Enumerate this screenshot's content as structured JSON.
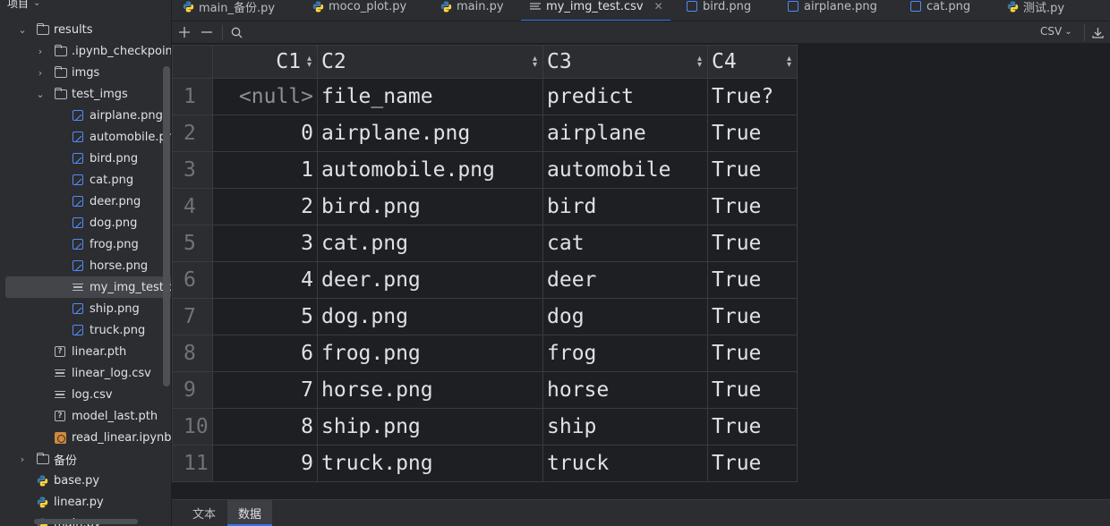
{
  "sidebar": {
    "title": "项目",
    "items": [
      {
        "label": "results",
        "type": "folder",
        "expanded": true,
        "icon": "folder-icon"
      },
      {
        "label": ".ipynb_checkpoints",
        "type": "folder",
        "expanded": false,
        "icon": "folder-icon"
      },
      {
        "label": "imgs",
        "type": "folder",
        "expanded": false,
        "icon": "folder-icon"
      },
      {
        "label": "test_imgs",
        "type": "folder",
        "expanded": true,
        "icon": "folder-icon"
      },
      {
        "label": "airplane.png",
        "type": "image",
        "icon": "image-file-icon"
      },
      {
        "label": "automobile.png",
        "type": "image",
        "icon": "image-file-icon"
      },
      {
        "label": "bird.png",
        "type": "image",
        "icon": "image-file-icon"
      },
      {
        "label": "cat.png",
        "type": "image",
        "icon": "image-file-icon"
      },
      {
        "label": "deer.png",
        "type": "image",
        "icon": "image-file-icon"
      },
      {
        "label": "dog.png",
        "type": "image",
        "icon": "image-file-icon"
      },
      {
        "label": "frog.png",
        "type": "image",
        "icon": "image-file-icon"
      },
      {
        "label": "horse.png",
        "type": "image",
        "icon": "image-file-icon"
      },
      {
        "label": "my_img_test.csv",
        "type": "text",
        "icon": "text-file-icon",
        "selected": true
      },
      {
        "label": "ship.png",
        "type": "image",
        "icon": "image-file-icon"
      },
      {
        "label": "truck.png",
        "type": "image",
        "icon": "image-file-icon"
      },
      {
        "label": "linear.pth",
        "type": "unknown",
        "icon": "unknown-file-icon"
      },
      {
        "label": "linear_log.csv",
        "type": "text",
        "icon": "text-file-icon"
      },
      {
        "label": "log.csv",
        "type": "text",
        "icon": "text-file-icon"
      },
      {
        "label": "model_last.pth",
        "type": "unknown",
        "icon": "unknown-file-icon"
      },
      {
        "label": "read_linear.ipynb",
        "type": "notebook",
        "icon": "notebook-file-icon"
      },
      {
        "label": "备份",
        "type": "folder",
        "expanded": false,
        "icon": "folder-icon"
      },
      {
        "label": "base.py",
        "type": "python",
        "icon": "python-file-icon"
      },
      {
        "label": "linear.py",
        "type": "python",
        "icon": "python-file-icon"
      },
      {
        "label": "main.py",
        "type": "python",
        "icon": "python-file-icon"
      }
    ]
  },
  "tabs": [
    {
      "label": "main_备份.py",
      "icon": "python-file-icon"
    },
    {
      "label": "moco_plot.py",
      "icon": "python-file-icon"
    },
    {
      "label": "main.py",
      "icon": "python-file-icon"
    },
    {
      "label": "my_img_test.csv",
      "icon": "text-file-icon",
      "active": true
    },
    {
      "label": "bird.png",
      "icon": "image-file-icon"
    },
    {
      "label": "airplane.png",
      "icon": "image-file-icon"
    },
    {
      "label": "cat.png",
      "icon": "image-file-icon"
    },
    {
      "label": "测试.py",
      "icon": "python-file-icon"
    }
  ],
  "toolbar": {
    "add_icon": "plus-icon",
    "remove_icon": "minus-icon",
    "search_icon": "search-icon",
    "format_label": "CSV",
    "export_icon": "download-icon"
  },
  "table": {
    "columns": [
      "C1",
      "C2",
      "C3",
      "C4"
    ],
    "rows": [
      {
        "n": "1",
        "c1": "<null>",
        "c2": "file_name",
        "c3": "predict",
        "c4": "True?"
      },
      {
        "n": "2",
        "c1": "0",
        "c2": "airplane.png",
        "c3": "airplane",
        "c4": "True"
      },
      {
        "n": "3",
        "c1": "1",
        "c2": "automobile.png",
        "c3": "automobile",
        "c4": "True"
      },
      {
        "n": "4",
        "c1": "2",
        "c2": "bird.png",
        "c3": "bird",
        "c4": "True"
      },
      {
        "n": "5",
        "c1": "3",
        "c2": "cat.png",
        "c3": "cat",
        "c4": "True"
      },
      {
        "n": "6",
        "c1": "4",
        "c2": "deer.png",
        "c3": "deer",
        "c4": "True"
      },
      {
        "n": "7",
        "c1": "5",
        "c2": "dog.png",
        "c3": "dog",
        "c4": "True"
      },
      {
        "n": "8",
        "c1": "6",
        "c2": "frog.png",
        "c3": "frog",
        "c4": "True"
      },
      {
        "n": "9",
        "c1": "7",
        "c2": "horse.png",
        "c3": "horse",
        "c4": "True"
      },
      {
        "n": "10",
        "c1": "8",
        "c2": "ship.png",
        "c3": "ship",
        "c4": "True"
      },
      {
        "n": "11",
        "c1": "9",
        "c2": "truck.png",
        "c3": "truck",
        "c4": "True"
      }
    ]
  },
  "bottom_tabs": [
    {
      "label": "文本",
      "active": false
    },
    {
      "label": "数据",
      "active": true
    }
  ],
  "colors": {
    "accent": "#3574f0",
    "python_blue": "#3c78aa",
    "python_yellow": "#ffd43b",
    "image_icon": "#548af7"
  }
}
